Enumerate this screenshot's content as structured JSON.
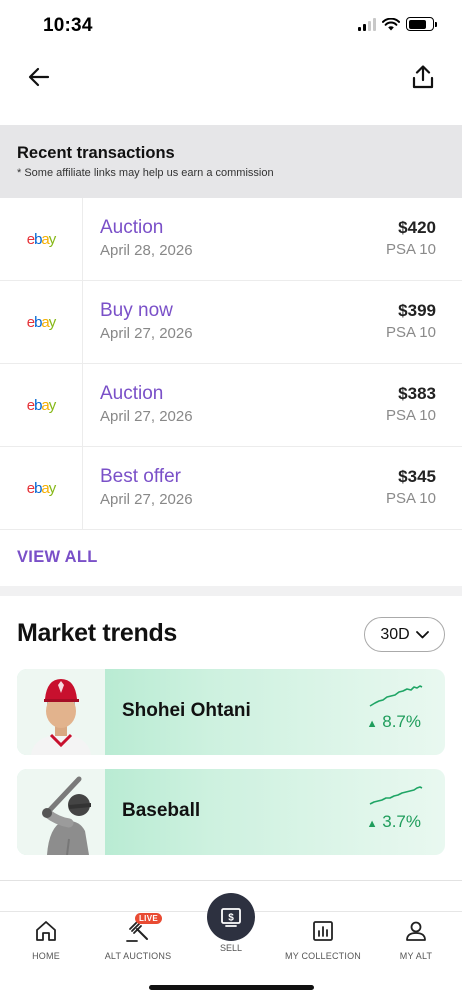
{
  "status_bar": {
    "time": "10:34"
  },
  "transactions": {
    "title": "Recent transactions",
    "subtitle": "* Some affiliate links may help us earn a commission",
    "rows": [
      {
        "marketplace": "ebay",
        "type": "Auction",
        "date": "April 28, 2026",
        "price": "$420",
        "grade": "PSA 10"
      },
      {
        "marketplace": "ebay",
        "type": "Buy now",
        "date": "April 27, 2026",
        "price": "$399",
        "grade": "PSA 10"
      },
      {
        "marketplace": "ebay",
        "type": "Auction",
        "date": "April 27, 2026",
        "price": "$383",
        "grade": "PSA 10"
      },
      {
        "marketplace": "ebay",
        "type": "Best offer",
        "date": "April 27, 2026",
        "price": "$345",
        "grade": "PSA 10"
      }
    ],
    "view_all": "VIEW ALL"
  },
  "market_trends": {
    "title": "Market trends",
    "period": "30D",
    "cards": [
      {
        "name": "Shohei Ohtani",
        "change": "8.7%",
        "direction": "up"
      },
      {
        "name": "Baseball",
        "change": "3.7%",
        "direction": "up"
      }
    ]
  },
  "tabbar": {
    "home": "HOME",
    "alt_auctions": "ALT AUCTIONS",
    "live_badge": "LIVE",
    "sell": "SELL",
    "my_collection": "MY COLLECTION",
    "my_alt": "MY ALT"
  },
  "colors": {
    "accent": "#7a50c8",
    "positive": "#1f9d5c",
    "sell_button": "#2d3140"
  }
}
